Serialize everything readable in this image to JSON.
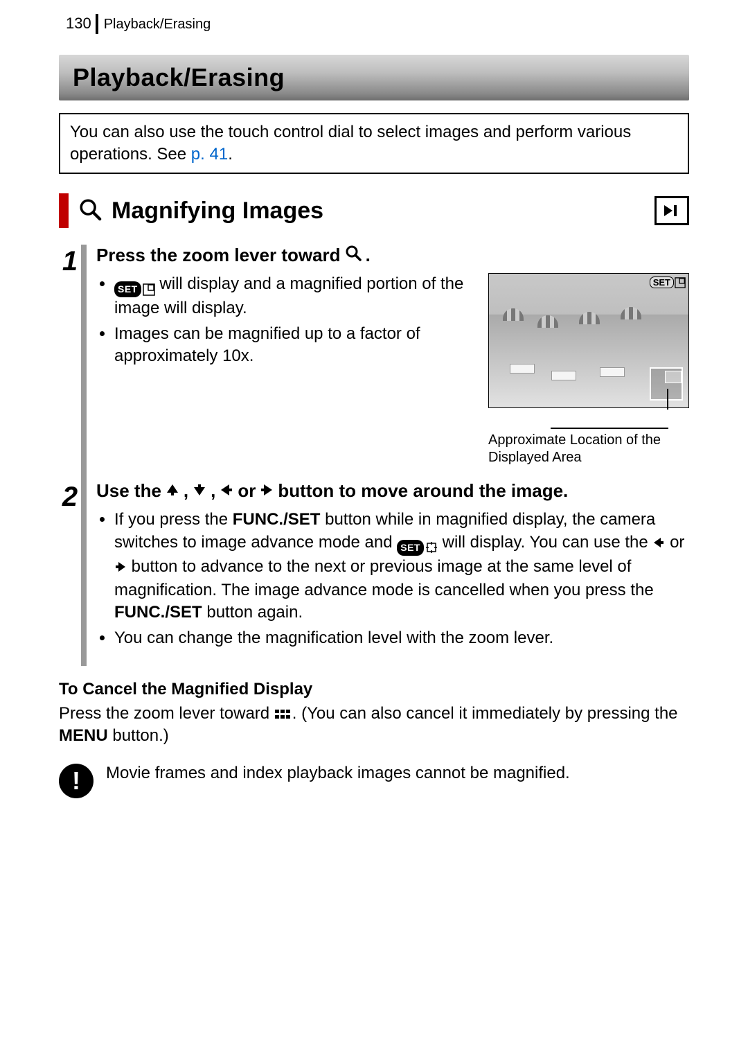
{
  "header": {
    "page_number": "130",
    "breadcrumb": "Playback/Erasing"
  },
  "chapter_title": "Playback/Erasing",
  "intro": {
    "text_a": "You can also use the touch control dial to select images and perform various operations. See ",
    "link": "p. 41",
    "text_b": "."
  },
  "section": {
    "title": "Magnifying Images"
  },
  "step1": {
    "num": "1",
    "head_a": "Press the zoom lever toward ",
    "head_b": ".",
    "bullet1_a": " will display and a magnified portion of the image will display.",
    "bullet2": "Images can be magnified up to a factor of approximately 10x.",
    "caption": "Approximate Location of the Displayed Area",
    "set_label": "SET"
  },
  "step2": {
    "num": "2",
    "head_a": "Use the ",
    "head_b": ", ",
    "head_c": ", ",
    "head_d": " or ",
    "head_e": " button to move around the image.",
    "bullet1_a": "If you press the ",
    "bullet1_func": "FUNC./SET",
    "bullet1_b": " button while in magnified display, the camera switches to image advance mode and ",
    "bullet1_c": " will display. You can use the ",
    "bullet1_d": " or ",
    "bullet1_e": " button to advance to the next or previous image at the same level of magnification. The image advance mode is cancelled when you press the ",
    "bullet1_func2": "FUNC./SET",
    "bullet1_f": " button again.",
    "bullet2": "You can change the magnification level with the zoom lever.",
    "set_label": "SET"
  },
  "cancel": {
    "head": "To Cancel the Magnified Display",
    "body_a": "Press the zoom lever toward ",
    "body_b": ". (You can also cancel it immediately by pressing the ",
    "menu": "MENU",
    "body_c": " button.)"
  },
  "note": {
    "icon": "!",
    "text": "Movie frames and index playback images cannot be magnified."
  }
}
